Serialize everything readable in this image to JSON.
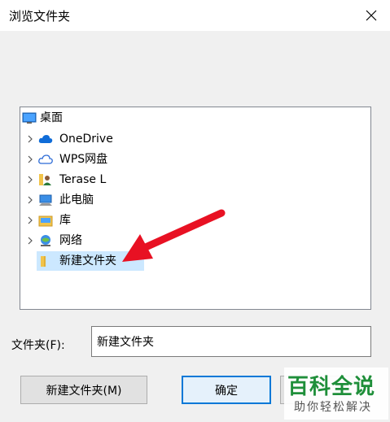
{
  "window": {
    "title": "浏览文件夹"
  },
  "tree": {
    "items": [
      {
        "label": "桌面",
        "icon": "desktop-icon",
        "has_children": false
      },
      {
        "label": "OneDrive",
        "icon": "cloud-icon",
        "has_children": true
      },
      {
        "label": "WPS网盘",
        "icon": "cloud-outline-icon",
        "has_children": true
      },
      {
        "label": "Terase L",
        "icon": "user-folder-icon",
        "has_children": true
      },
      {
        "label": "此电脑",
        "icon": "computer-icon",
        "has_children": true
      },
      {
        "label": "库",
        "icon": "library-icon",
        "has_children": true
      },
      {
        "label": "网络",
        "icon": "network-icon",
        "has_children": true
      },
      {
        "label": "新建文件夹",
        "icon": "folder-icon",
        "has_children": false,
        "selected": true
      }
    ]
  },
  "folder": {
    "label": "文件夹(F):",
    "value": "新建文件夹"
  },
  "buttons": {
    "new_folder": "新建文件夹(M)",
    "ok": "确定",
    "cancel": ""
  },
  "watermark": {
    "main": "百科全说",
    "sub": "助你轻松解决"
  },
  "colors": {
    "accent": "#0078d7",
    "selection": "#cce8ff",
    "arrow": "#e81123"
  }
}
